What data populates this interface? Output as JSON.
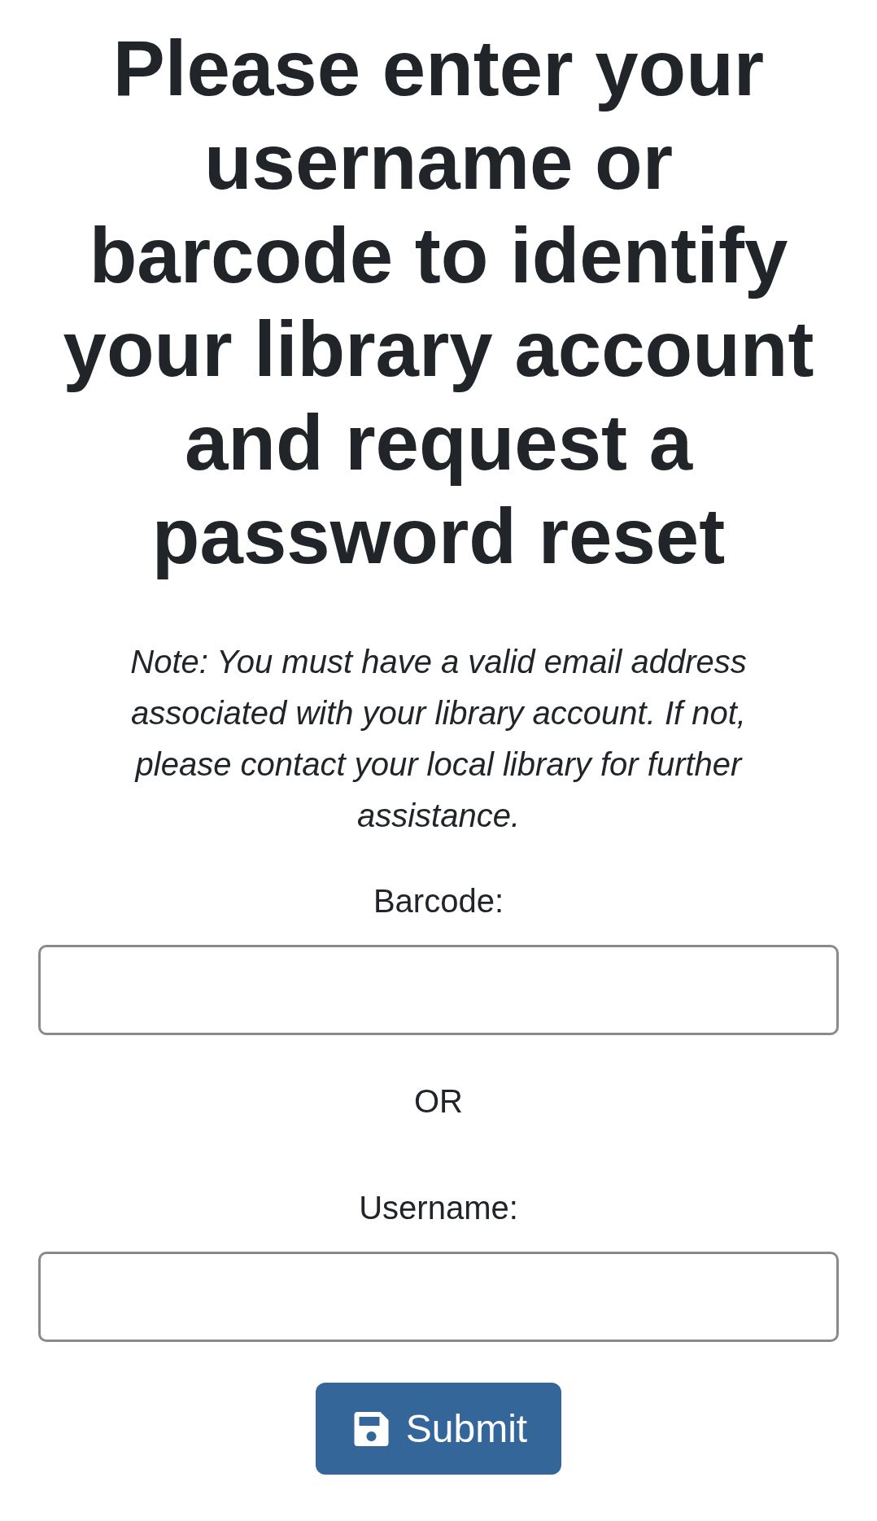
{
  "heading": "Please enter your username or barcode to identify your library account and request a password reset",
  "note": "Note: You must have a valid email address associated with your library account. If not, please contact your local library for further assistance.",
  "fields": [
    {
      "label": "Barcode:"
    },
    {
      "label": "Username:"
    }
  ],
  "separator": "OR",
  "submit_button": {
    "label": "Submit"
  }
}
